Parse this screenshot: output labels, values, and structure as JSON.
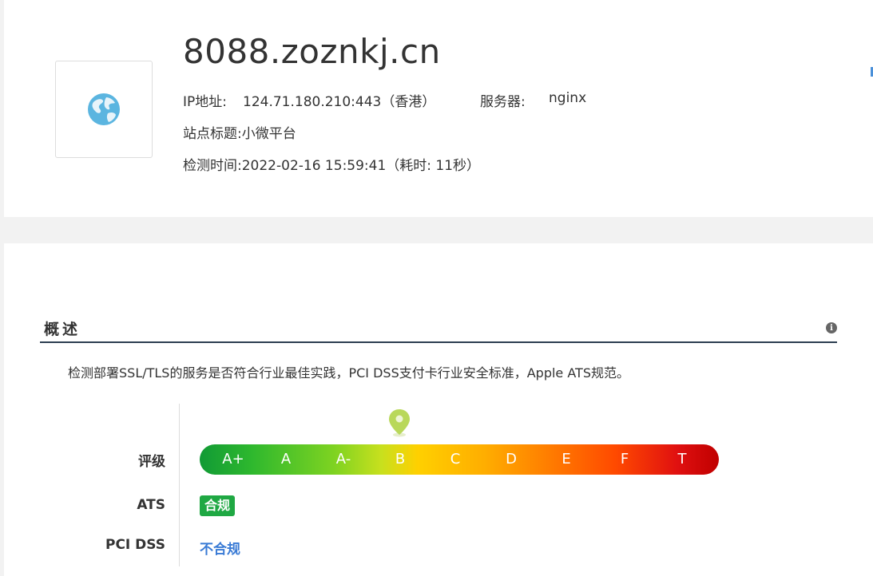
{
  "site": {
    "domain": "8088.zoznkj.cn",
    "ip_label": "IP地址:",
    "ip_value": "124.71.180.210:443（香港）",
    "server_label": "服务器:",
    "server_value": "nginx",
    "title_label": "站点标题:",
    "title_value": "小微平台",
    "time_label": "检测时间:",
    "time_value": "2022-02-16 15:59:41（耗时: 11秒）",
    "favicon_icon": "globe-icon"
  },
  "overview": {
    "section_title": "概述",
    "info_icon": "info-icon",
    "description": "检测部署SSL/TLS的服务是否符合行业最佳实践，PCI DSS支付卡行业安全标准，Apple ATS规范。",
    "grade_label": "评级",
    "grades": [
      "A+",
      "A",
      "A-",
      "B",
      "C",
      "D",
      "E",
      "F",
      "T"
    ],
    "current_grade": "B",
    "ats_label": "ATS",
    "ats_value": "合规",
    "pci_label": "PCI DSS",
    "pci_value": "不合规",
    "colors": {
      "ats_badge": "#1fa843",
      "pci_value": "#3a7bd5",
      "pin": "#b9d85a"
    }
  }
}
